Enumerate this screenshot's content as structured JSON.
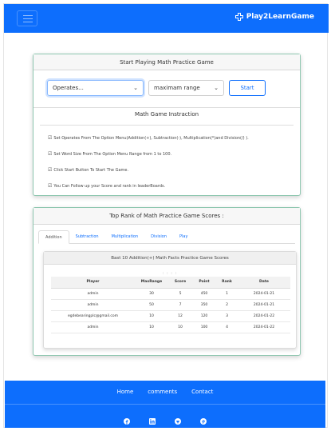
{
  "brand": {
    "name": "Play2LearnGame"
  },
  "game": {
    "title": "Start Playing Math Practice Game",
    "operates_value": "Operates...",
    "range_value": "maximam range",
    "start_label": "Start",
    "instruction_title": "Math Game Instraction",
    "instructions": [
      "Set Operates From The Option Menu(Addition(+), Subtraction(-), Multiplication(*)and Division(/) ).",
      "Set Word Size From The Option Menu Range from 1 to 100.",
      "Click Start Button To Start The Game.",
      "You Can Follow up your Score and rank in leaderBoards."
    ]
  },
  "rank": {
    "title": "Top Rank of Math Practice Game Scores :",
    "tabs": [
      "Addition",
      "Subtraction",
      "Multiplication",
      "Division",
      "Play"
    ],
    "inner_title": "Bast 10 Addition(+) Math Facts Practice Game Scores",
    "dots": ": : : :",
    "columns": [
      "Player",
      "MaxRange",
      "Score",
      "Point",
      "Rank",
      "Date"
    ],
    "rows": [
      [
        "admin",
        "30",
        "5",
        "450",
        "1",
        "2024-01-21"
      ],
      [
        "admin",
        "50",
        "7",
        "350",
        "2",
        "2024-01-21"
      ],
      [
        "egdebearingplc@gmail.com",
        "10",
        "12",
        "120",
        "3",
        "2024-01-22"
      ],
      [
        "admin",
        "10",
        "10",
        "100",
        "4",
        "2024-01-22"
      ]
    ]
  },
  "footer": {
    "links": [
      "Home",
      "comments",
      "Contact"
    ],
    "social_icons": [
      "facebook-icon",
      "linkedin-icon",
      "github-icon",
      "pinterest-icon"
    ]
  },
  "colors": {
    "primary": "#0d6efd",
    "card_border": "#8fc7b0"
  }
}
